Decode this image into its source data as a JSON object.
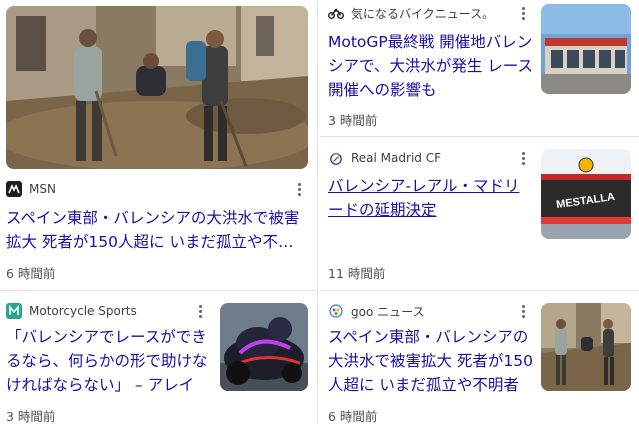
{
  "articles": [
    {
      "source": "MSN",
      "title": "スペイン東部・バレンシアの大洪水で被害拡大 死者が150人超に いまだ孤立や不明者も",
      "time": "6 時間前"
    },
    {
      "source": "Motorcycle Sports",
      "title": "「バレンシアでレースができるなら、何らかの形で助けなければならない」 – アレイシ・エスパルガロ",
      "time": "3 時間前"
    },
    {
      "source": "気になるバイクニュース。",
      "title": "MotoGP最終戦 開催地バレンシアで、大洪水が発生 レース開催への影響も",
      "time": "3 時間前"
    },
    {
      "source": "Real Madrid CF",
      "title": "バレンシア-レアル・マドリードの延期決定",
      "time": "11 時間前",
      "thumb_text": "MESTALLA"
    },
    {
      "source": "goo ニュース",
      "title": "スペイン東部・バレンシアの大洪水で被害拡大 死者が150人超に いまだ孤立や不明者も",
      "time": "6 時間前"
    }
  ],
  "colors": {
    "link": "#1a0dab",
    "meta": "#4d5156",
    "divider": "#e3e3e3"
  }
}
